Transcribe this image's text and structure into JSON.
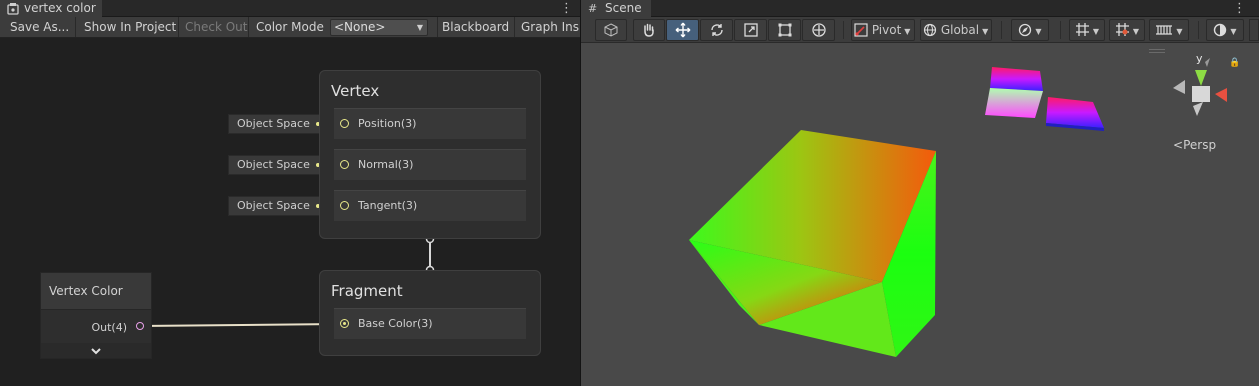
{
  "left_panel": {
    "tab_title": "vertex color",
    "tab_icon": "shader-graph-icon",
    "toolbar": {
      "save_as": "Save As...",
      "show_in_project": "Show In Project",
      "check_out": "Check Out",
      "color_mode_label": "Color Mode",
      "color_mode_value": "<None>",
      "blackboard": "Blackboard",
      "graph_inspector": "Graph Insp"
    },
    "vertex_node": {
      "title": "Vertex",
      "slots": [
        "Position(3)",
        "Normal(3)",
        "Tangent(3)"
      ],
      "inputs": [
        "Object Space",
        "Object Space",
        "Object Space"
      ]
    },
    "fragment_node": {
      "title": "Fragment",
      "slots": [
        "Base Color(3)"
      ]
    },
    "vertex_color_node": {
      "title": "Vertex Color",
      "output": "Out(4)"
    }
  },
  "right_panel": {
    "tab_title": "Scene",
    "tab_icon": "grid-icon",
    "toolbar": {
      "pivot": "Pivot",
      "global": "Global"
    },
    "gizmo": {
      "label": "Persp",
      "axis_y": "y"
    }
  },
  "colors": {
    "accent_active": "#46607c",
    "port_yellow": "#e8e88a",
    "port_pink": "#e8a0e8",
    "scene_bg": "#494949"
  }
}
